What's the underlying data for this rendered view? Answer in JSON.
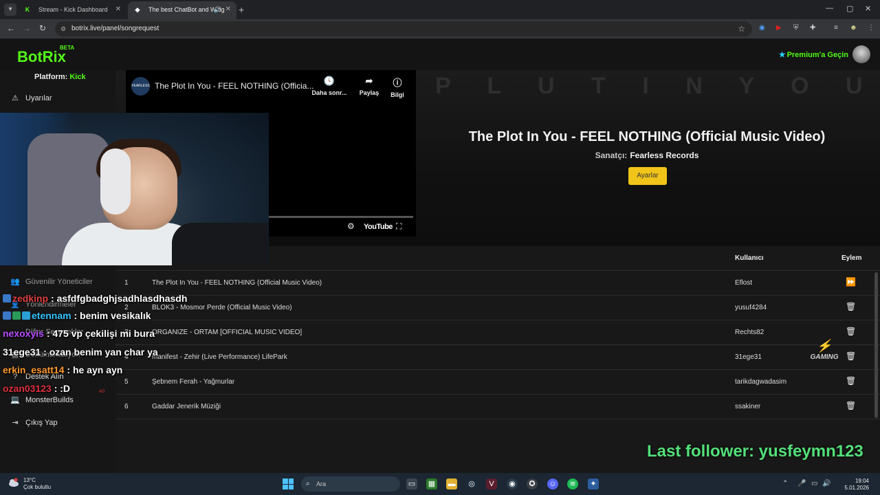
{
  "browser": {
    "tabs": [
      {
        "title": "Stream - Kick Dashboard",
        "favicon": "kick-icon"
      },
      {
        "title": "The best ChatBot and Widg",
        "favicon": "botrix-icon"
      }
    ],
    "url": "botrix.live/panel/songrequest"
  },
  "app": {
    "logo": "BotRix",
    "beta": "BETA",
    "premium": "Premium'a Geçin",
    "platform_label": "Platform:",
    "platform_value": "Kick"
  },
  "sidebar": {
    "items": [
      {
        "label": "Uyarılar",
        "icon": "warning-icon"
      },
      {
        "label": "Güvenilir Yöneticiler",
        "icon": "users-icon"
      },
      {
        "label": "Yönlendirmeler",
        "icon": "user-icon"
      },
      {
        "label": "Diğer Seçenekler",
        "icon": "more-icon"
      },
      {
        "label": "Dokümantasyon",
        "icon": "book-icon"
      },
      {
        "label": "Destek Alın",
        "icon": "help-icon"
      },
      {
        "label": "MonsterBuilds",
        "icon": "laptop-icon"
      },
      {
        "label": "Çıkış Yap",
        "icon": "logout-icon"
      }
    ]
  },
  "player": {
    "video_title": "The Plot In You - FEEL NOTHING (Officia...",
    "channel_logo": "FEARLESS",
    "actions": [
      {
        "label": "Daha sonr...",
        "icon": "clock-icon"
      },
      {
        "label": "Paylaş",
        "icon": "share-icon"
      },
      {
        "label": "Bilgi",
        "icon": "info-icon"
      }
    ],
    "youtube_label": "YouTube",
    "bg_text": "P L U T   I N   Y O U",
    "now_title": "The Plot In You - FEEL NOTHING (Official Music Video)",
    "artist_label": "Sanatçı:",
    "artist_value": "Fearless Records",
    "settings_button": "Ayarlar"
  },
  "table": {
    "headers": {
      "user": "Kullanıcı",
      "action": "Eylem"
    },
    "rows": [
      {
        "num": "1",
        "song": "The Plot In You - FEEL NOTHING (Official Music Video)",
        "user": "Eflost",
        "action": "skip-icon"
      },
      {
        "num": "2",
        "song": "BLOK3 - Mosmor Perde (Official Music Video)",
        "user": "yusuf4284",
        "action": "trash-icon"
      },
      {
        "num": "3",
        "song": "ORGANIZE - ORTAM [OFFICIAL MUSIC VIDEO]",
        "user": "Rechts82",
        "action": "trash-icon"
      },
      {
        "num": "4",
        "song": "manifest - Zehir (Live Performance) LifePark",
        "user": "31ege31",
        "action": "trash-icon"
      },
      {
        "num": "5",
        "song": "Şebnem Ferah - Yağmurlar",
        "user": "tarikdagwadasim",
        "action": "trash-icon"
      },
      {
        "num": "6",
        "song": "Gaddar Jenerik Müziği",
        "user": "ssakiner",
        "action": "trash-icon"
      }
    ]
  },
  "overlay": {
    "chat": [
      {
        "name": "zedkinp",
        "text": ": asfdfgbadghjsadhlasdhasdh",
        "color": "#e04040"
      },
      {
        "name": "etennam",
        "text": ": benim vesikalık",
        "color": "#36c6ff"
      },
      {
        "name": "nexoxyis",
        "text": ": 475 vp çekilişi mi bura",
        "color": "#b84bff"
      },
      {
        "name": "31ege31",
        "text": ": ozan benim yan char ya",
        "color": "#ffffff"
      },
      {
        "name": "erkin_esatt14",
        "text": ": he ayn ayn",
        "color": "#ff9a2e"
      },
      {
        "name": "ozan03123",
        "text": ": :D",
        "color": "#e03040"
      }
    ],
    "last_follower": "Last follower: yusfeymn123",
    "gaming_logo": "GAMING"
  },
  "taskbar": {
    "temperature": "13°C",
    "weather": "Çok bulutlu",
    "search_placeholder": "Ara",
    "time": "19:04",
    "date": "5.01.2026"
  },
  "colors": {
    "accent": "#53fc18",
    "button": "#f0c419",
    "follower": "#53e07a"
  }
}
